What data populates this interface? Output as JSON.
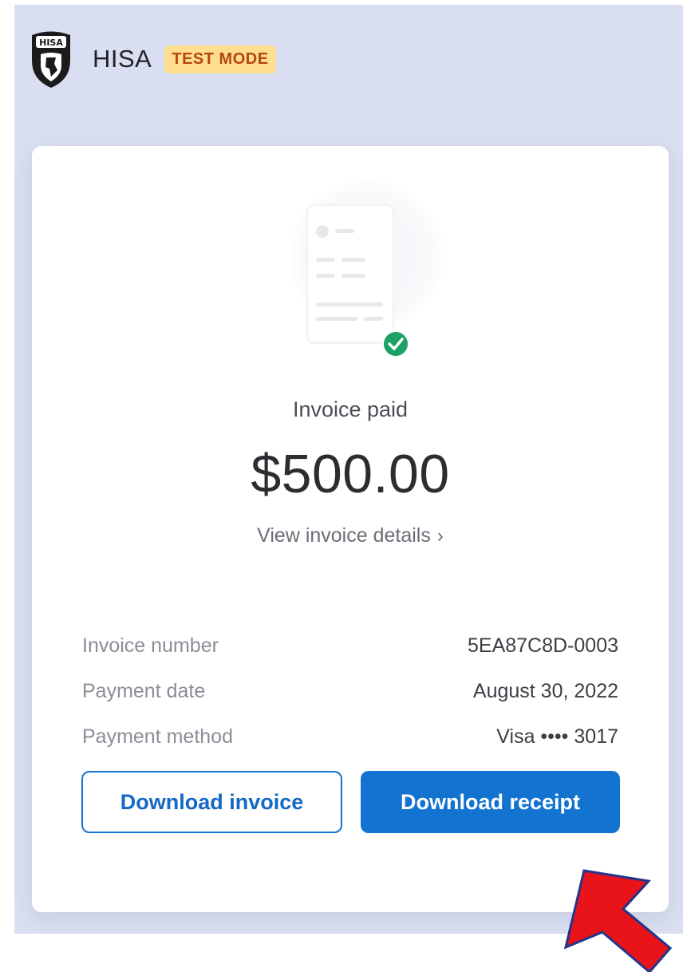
{
  "header": {
    "brand_name": "HISA",
    "badge": "TEST MODE",
    "logo_text": "HISA"
  },
  "invoice": {
    "status": "Invoice paid",
    "amount": "$500.00",
    "details_link": "View invoice details",
    "details_chevron": "›"
  },
  "details": [
    {
      "label": "Invoice number",
      "value": "5EA87C8D-0003"
    },
    {
      "label": "Payment date",
      "value": "August 30, 2022"
    },
    {
      "label": "Payment method",
      "value": "Visa •••• 3017"
    }
  ],
  "actions": {
    "download_invoice": "Download invoice",
    "download_receipt": "Download receipt"
  },
  "colors": {
    "page_background": "#d9def0",
    "primary": "#1373d1",
    "badge_background": "#ffde92",
    "badge_text": "#b3470e",
    "success": "#1aa163",
    "annotation_arrow": "#e8141a"
  },
  "icons": {
    "logo": "hisa-shield-logo",
    "illustration": "invoice-document-icon",
    "status": "check-circle-icon",
    "chevron": "chevron-right-icon",
    "annotation": "red-arrow-annotation"
  }
}
